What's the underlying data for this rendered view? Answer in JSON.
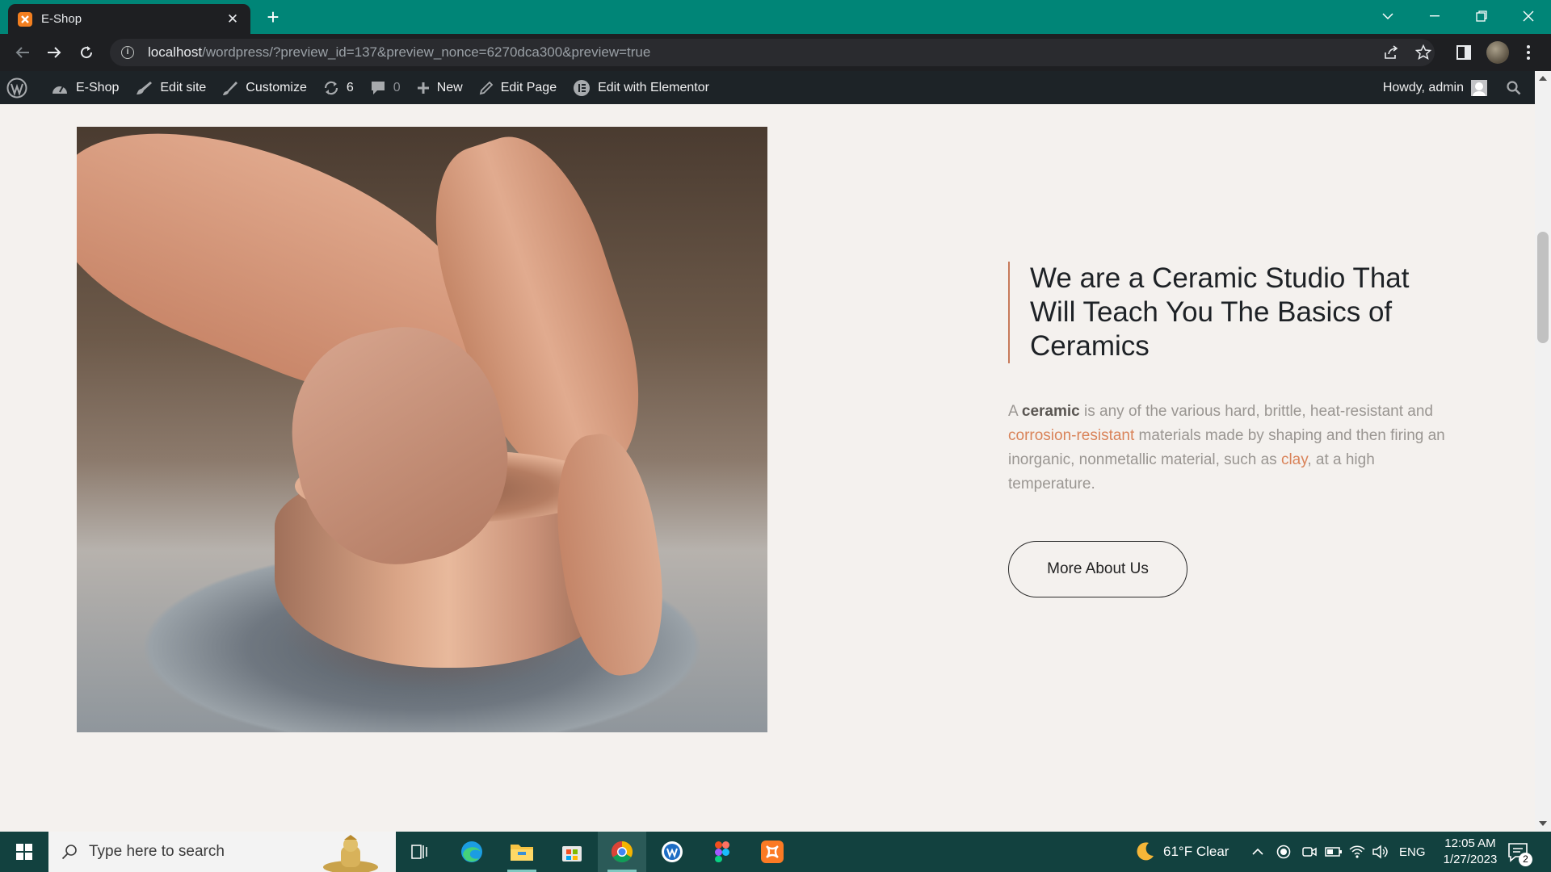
{
  "browser": {
    "tab_title": "E-Shop",
    "url_host": "localhost",
    "url_path": "/wordpress/?preview_id=137&preview_nonce=6270dca300&preview=true",
    "theme_color": "#008577"
  },
  "wp_admin_bar": {
    "site_name": "E-Shop",
    "edit_site": "Edit site",
    "customize": "Customize",
    "updates_count": "6",
    "comments_count": "0",
    "new": "New",
    "edit_page": "Edit Page",
    "edit_with_elementor": "Edit with Elementor",
    "howdy": "Howdy, admin"
  },
  "page": {
    "heading": "We are a Ceramic Studio That Will Teach You The Basics of Ceramics",
    "body": {
      "t1": "A ",
      "bold": "ceramic",
      "t2": " is any of the various hard, brittle, heat-resistant and ",
      "link1": "corrosion-resistant",
      "t3": " materials made by shaping and then firing an inorganic, nonmetallic material, such as ",
      "link2": "clay",
      "t4": ", at a high temperature."
    },
    "button_label": "More About Us",
    "accent_color": "#d98359",
    "image_alt": "Hands shaping clay pot on pottery wheel"
  },
  "taskbar": {
    "search_placeholder": "Type here to search",
    "weather": "61°F  Clear",
    "language": "ENG",
    "time": "12:05 AM",
    "date": "1/27/2023",
    "notification_count": "2"
  }
}
